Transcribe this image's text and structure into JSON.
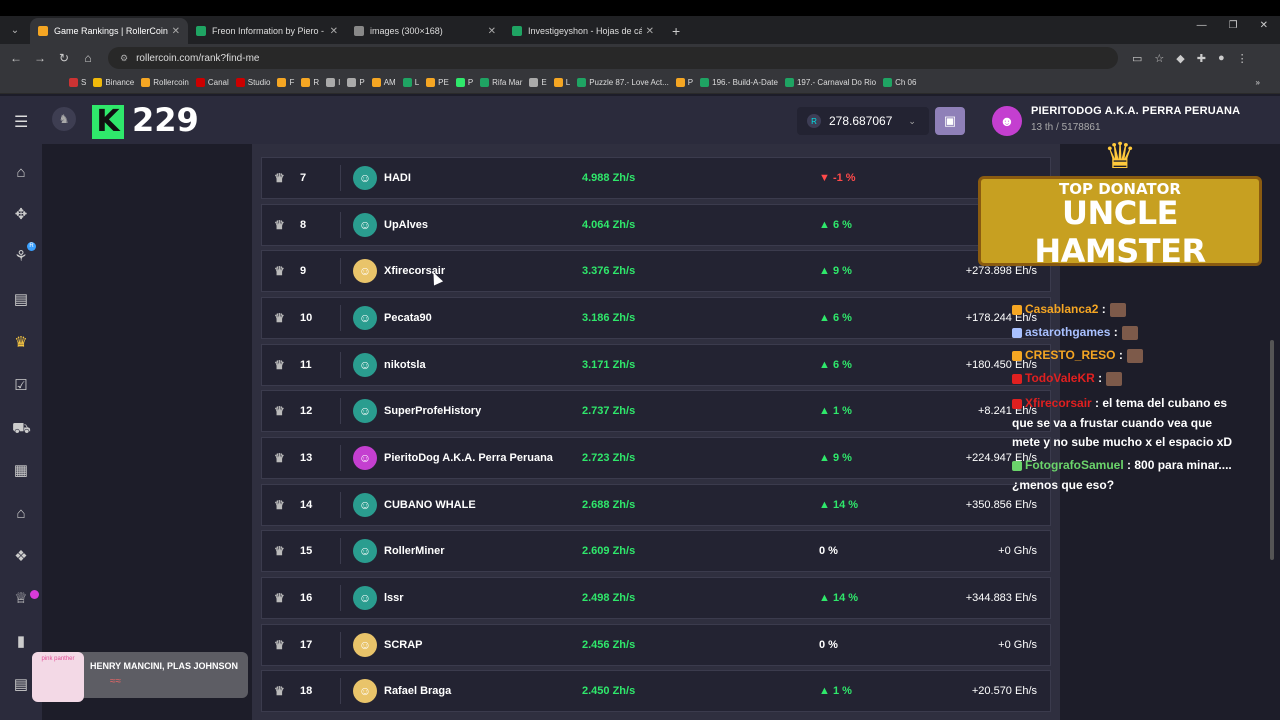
{
  "browser": {
    "tabs": [
      {
        "label": "Game Rankings | RollerCoin.com",
        "color": "#f5a623",
        "active": true
      },
      {
        "label": "Freon Information by Piero - Ho",
        "color": "#1fa463"
      },
      {
        "label": "images (300×168)",
        "color": "#888888"
      },
      {
        "label": "Investigeyshon - Hojas de cálcu",
        "color": "#1fa463"
      }
    ],
    "url": "rollercoin.com/rank?find-me",
    "bookmarks": [
      {
        "label": "S",
        "color": "#c33"
      },
      {
        "label": "Binance",
        "color": "#f0b90b"
      },
      {
        "label": "Rollercoin",
        "color": "#f5a623"
      },
      {
        "label": "Canal",
        "color": "#c00"
      },
      {
        "label": "Studio",
        "color": "#c00"
      },
      {
        "label": "F",
        "color": "#f5a623"
      },
      {
        "label": "R",
        "color": "#f5a623"
      },
      {
        "label": "I",
        "color": "#aaa"
      },
      {
        "label": "P",
        "color": "#aaa"
      },
      {
        "label": "AM",
        "color": "#f5a623"
      },
      {
        "label": "L",
        "color": "#1fa463"
      },
      {
        "label": "PE",
        "color": "#f5a623"
      },
      {
        "label": "P",
        "color": "#2fe86b"
      },
      {
        "label": "Rifa Mar",
        "color": "#1fa463"
      },
      {
        "label": "E",
        "color": "#aaa"
      },
      {
        "label": "L",
        "color": "#f5a623"
      },
      {
        "label": "Puzzle 87.- Love Act...",
        "color": "#1fa463"
      },
      {
        "label": "P",
        "color": "#f5a623"
      },
      {
        "label": "196.- Build-A-Date",
        "color": "#1fa463"
      },
      {
        "label": "197.- Carnaval Do Rio",
        "color": "#1fa463"
      },
      {
        "label": "Ch 06",
        "color": "#1fa463"
      }
    ]
  },
  "header": {
    "overlay_count": "229",
    "balance": "278.687067",
    "username": "PIERITODOG A.K.A. PERRA PERUANA",
    "rank_text": "13 th / 5178861"
  },
  "rankings": [
    {
      "pos": "7",
      "name": "HADI",
      "power": "4.988 Zh/s",
      "change": "-1 %",
      "dir": "down",
      "delta": "",
      "avatar": "#2a9d8f"
    },
    {
      "pos": "8",
      "name": "UpAlves",
      "power": "4.064 Zh/s",
      "change": "6 %",
      "dir": "up",
      "delta": "+",
      "avatar": "#2a9d8f"
    },
    {
      "pos": "9",
      "name": "Xfirecorsair",
      "power": "3.376 Zh/s",
      "change": "9 %",
      "dir": "up",
      "delta": "+273.898 Eh/s",
      "avatar": "#e9c46a"
    },
    {
      "pos": "10",
      "name": "Pecata90",
      "power": "3.186 Zh/s",
      "change": "6 %",
      "dir": "up",
      "delta": "+178.244 Eh/s",
      "avatar": "#2a9d8f"
    },
    {
      "pos": "11",
      "name": "nikotsla",
      "power": "3.171 Zh/s",
      "change": "6 %",
      "dir": "up",
      "delta": "+180.450 Eh/s",
      "avatar": "#2a9d8f"
    },
    {
      "pos": "12",
      "name": "SuperProfeHistory",
      "power": "2.737 Zh/s",
      "change": "1 %",
      "dir": "up",
      "delta": "+8.241 Eh/s",
      "avatar": "#2a9d8f"
    },
    {
      "pos": "13",
      "name": "PieritoDog A.K.A. Perra Peruana",
      "power": "2.723 Zh/s",
      "change": "9 %",
      "dir": "up",
      "delta": "+224.947 Eh/s",
      "avatar": "#c43fd0"
    },
    {
      "pos": "14",
      "name": "CUBANO WHALE",
      "power": "2.688 Zh/s",
      "change": "14 %",
      "dir": "up",
      "delta": "+350.856 Eh/s",
      "avatar": "#2a9d8f"
    },
    {
      "pos": "15",
      "name": "RollerMiner",
      "power": "2.609 Zh/s",
      "change": "0 %",
      "dir": "zero",
      "delta": "+0 Gh/s",
      "avatar": "#2a9d8f"
    },
    {
      "pos": "16",
      "name": "lssr",
      "power": "2.498 Zh/s",
      "change": "14 %",
      "dir": "up",
      "delta": "+344.883 Eh/s",
      "avatar": "#2a9d8f"
    },
    {
      "pos": "17",
      "name": "SCRAP",
      "power": "2.456 Zh/s",
      "change": "0 %",
      "dir": "zero",
      "delta": "+0 Gh/s",
      "avatar": "#e9c46a"
    },
    {
      "pos": "18",
      "name": "Rafael Braga",
      "power": "2.450 Zh/s",
      "change": "1 %",
      "dir": "up",
      "delta": "+20.570 Eh/s",
      "avatar": "#e9c46a"
    }
  ],
  "donator": {
    "top": "TOP DONATOR",
    "name": "UNCLE HAMSTER"
  },
  "chat": [
    {
      "user": "Casablanca2",
      "color": "#f5a623",
      "msg": ":"
    },
    {
      "user": "astarothgames",
      "color": "#a9c1ff",
      "msg": ":"
    },
    {
      "user": "CRESTO_RESO",
      "color": "#f5a623",
      "msg": ":"
    },
    {
      "user": "TodoValeKR",
      "color": "#e02020",
      "msg": ":"
    },
    {
      "user": "Xfirecorsair",
      "color": "#e02020",
      "msg": ": el tema del cubano es que se va a frustar cuando vea que mete y no sube mucho x el espacio xD"
    },
    {
      "user": "FotografoSamuel",
      "color": "#6bd46b",
      "msg": ": 800 para minar....¿menos que eso?"
    }
  ],
  "music": {
    "title": "HENRY MANCINI, PLAS JOHNSON",
    "art_text": "pink panther"
  }
}
